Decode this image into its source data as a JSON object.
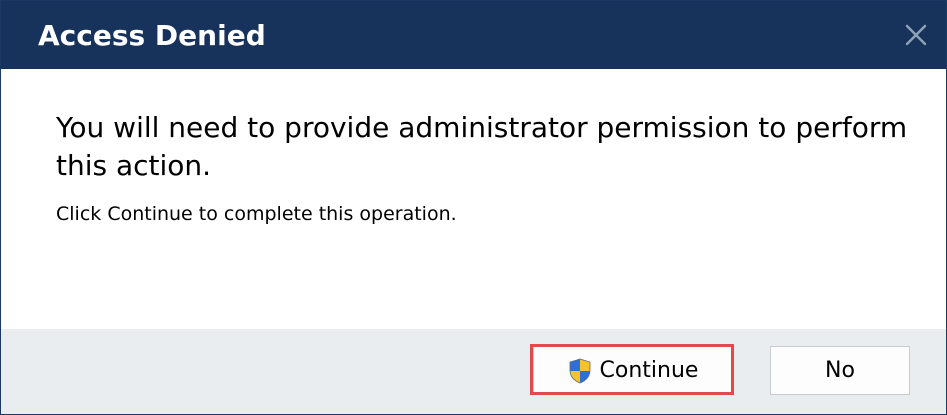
{
  "dialog": {
    "title": "Access Denied",
    "message": "You will need to provide administrator permission to perform this action.",
    "submessage": "Click Continue to complete this operation.",
    "buttons": {
      "continue_label": "Continue",
      "no_label": "No"
    },
    "icons": {
      "close": "close-icon",
      "continue": "uac-shield-icon"
    },
    "colors": {
      "titlebar": "#17325b",
      "footer": "#e9edf0",
      "highlight": "#e1494b"
    }
  }
}
